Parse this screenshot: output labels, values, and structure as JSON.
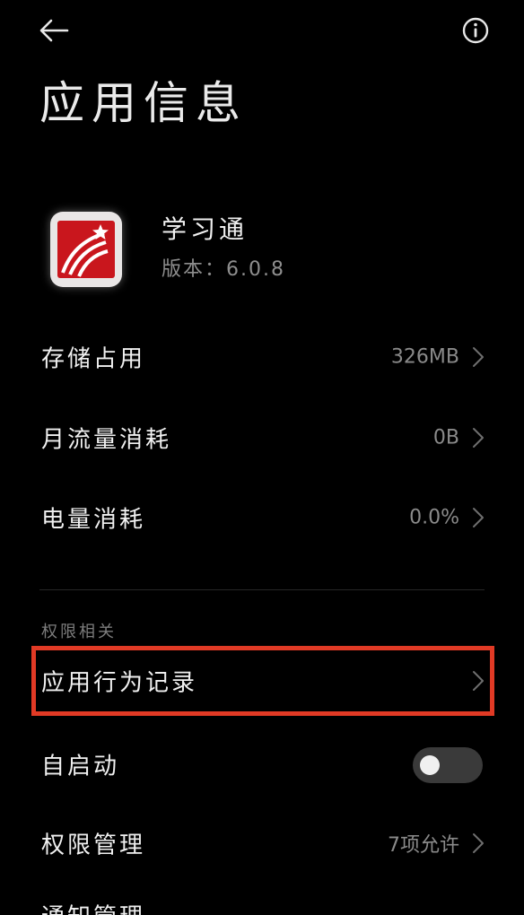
{
  "header": {
    "back_icon": "arrow-left-icon",
    "info_icon": "info-icon",
    "title": "应用信息"
  },
  "app": {
    "name": "学习通",
    "version": "版本：6.0.8",
    "icon_color": "#c9161d"
  },
  "usage": {
    "storage": {
      "label": "存储占用",
      "value": "326MB"
    },
    "data": {
      "label": "月流量消耗",
      "value": "0B"
    },
    "battery": {
      "label": "电量消耗",
      "value": "0.0%"
    }
  },
  "permissions": {
    "section_label": "权限相关",
    "behavior_record": {
      "label": "应用行为记录"
    },
    "autostart": {
      "label": "自启动",
      "enabled": false
    },
    "manage": {
      "label": "权限管理",
      "value": "7项允许"
    },
    "next": {
      "label": "通知管理"
    }
  },
  "accent": "#e13a25"
}
